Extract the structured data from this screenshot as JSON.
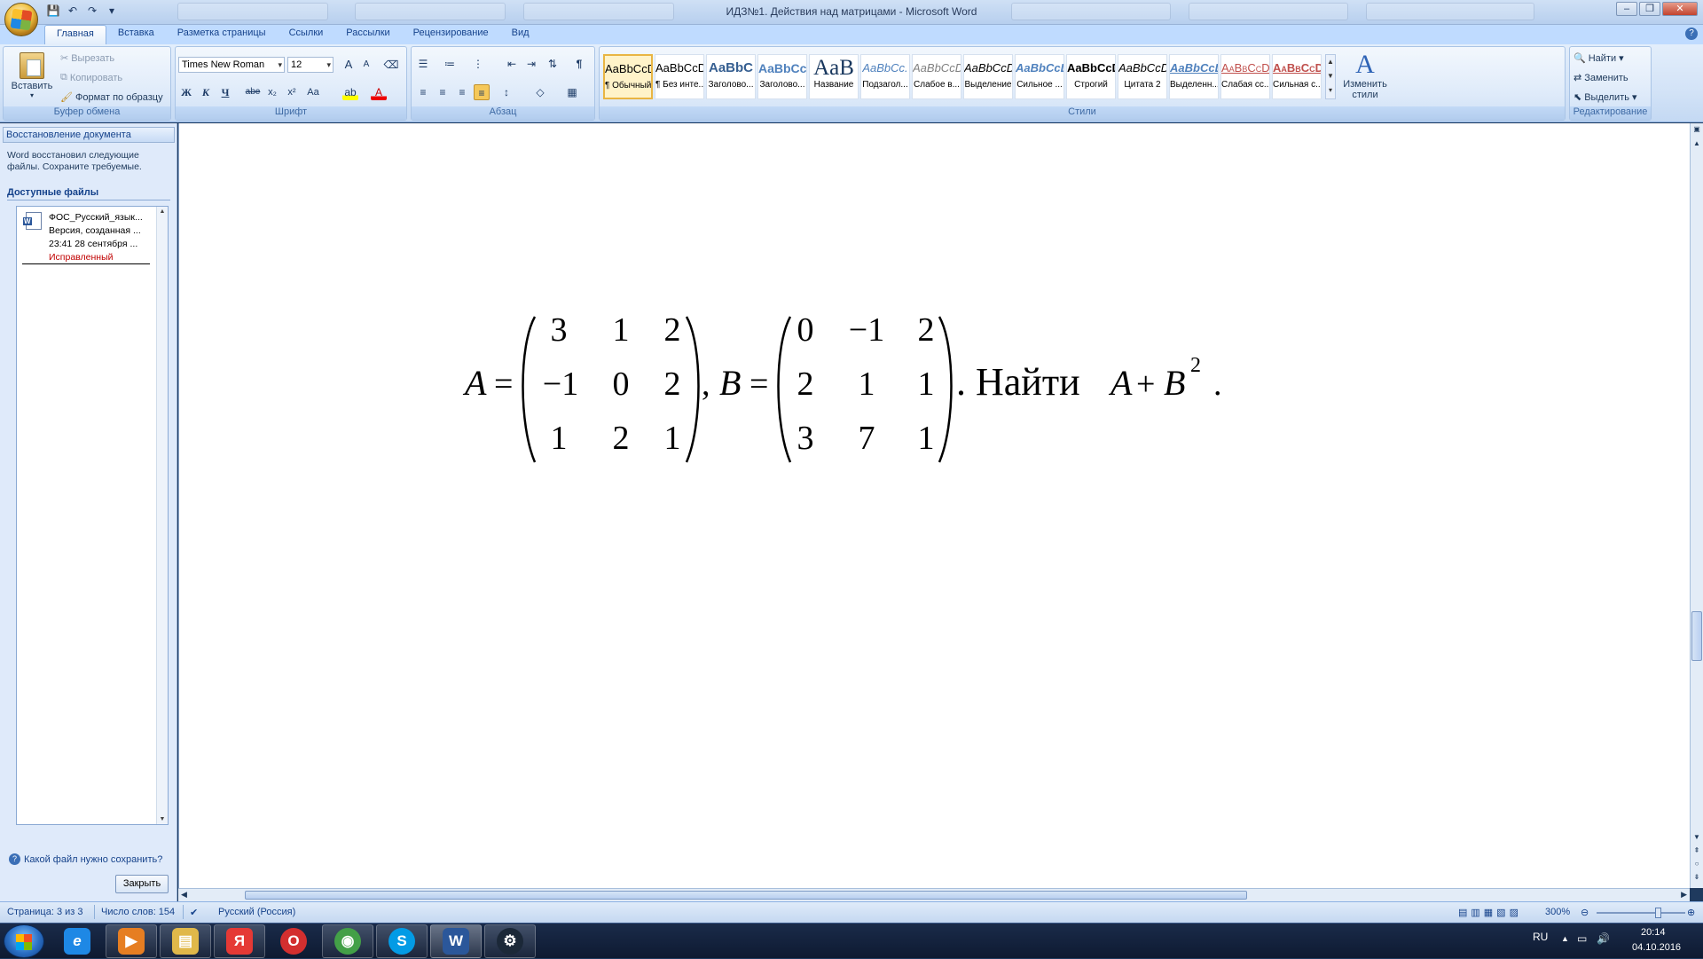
{
  "window": {
    "title": "ИДЗ№1. Действия над матрицами - Microsoft Word"
  },
  "qat": {
    "save": "💾",
    "undo": "↶",
    "redo": "↷",
    "more": "▾"
  },
  "tabs": [
    "Главная",
    "Вставка",
    "Разметка страницы",
    "Ссылки",
    "Рассылки",
    "Рецензирование",
    "Вид"
  ],
  "clipboard": {
    "paste": "Вставить",
    "cut": "Вырезать",
    "copy": "Копировать",
    "format_painter": "Формат по образцу",
    "label": "Буфер обмена"
  },
  "font": {
    "family": "Times New Roman",
    "size": "12",
    "label": "Шрифт",
    "bold": "Ж",
    "italic": "К",
    "underline": "Ч",
    "strike": "abe",
    "subscript": "x₂",
    "superscript": "x²",
    "change_case": "Aa",
    "grow": "A",
    "shrink": "A"
  },
  "paragraph": {
    "label": "Абзац"
  },
  "styles": {
    "label": "Стили",
    "items": [
      {
        "preview": "AaBbCcDc",
        "name": "¶ Обычный"
      },
      {
        "preview": "AaBbCcDc",
        "name": "¶ Без инте..."
      },
      {
        "preview": "AaBbC",
        "name": "Заголово..."
      },
      {
        "preview": "AaBbCc",
        "name": "Заголово..."
      },
      {
        "preview": "AaB",
        "name": "Название"
      },
      {
        "preview": "AaBbCc.",
        "name": "Подзагол..."
      },
      {
        "preview": "AaBbCcDı",
        "name": "Слабое в..."
      },
      {
        "preview": "AaBbCcDı",
        "name": "Выделение"
      },
      {
        "preview": "AaBbCcDı",
        "name": "Сильное ..."
      },
      {
        "preview": "AaBbCcDc",
        "name": "Строгий"
      },
      {
        "preview": "AaBbCcDı",
        "name": "Цитата 2"
      },
      {
        "preview": "AaBbCcDı",
        "name": "Выделенн..."
      },
      {
        "preview": "AaBbCcDı",
        "name": "Слабая сс..."
      },
      {
        "preview": "AaBbCcDı",
        "name": "Сильная с..."
      }
    ],
    "change_styles": "Изменить стили"
  },
  "editing": {
    "label": "Редактирование",
    "find": "Найти",
    "replace": "Заменить",
    "select": "Выделить"
  },
  "taskpane": {
    "title": "Восстановление документа",
    "text": "Word восстановил следующие файлы.  Сохраните требуемые.",
    "available": "Доступные файлы",
    "file": {
      "name": "ФОС_Русский_язык...",
      "line2": "Версия, созданная ...",
      "line3": "23:41 28 сентября ...",
      "status": "Исправленный"
    },
    "question": "Какой файл нужно сохранить?",
    "close": "Закрыть"
  },
  "document": {
    "matrix_a": [
      [
        "3",
        "1",
        "2"
      ],
      [
        "−1",
        "0",
        "2"
      ],
      [
        "1",
        "2",
        "1"
      ]
    ],
    "matrix_b": [
      [
        "0",
        "−1",
        "2"
      ],
      [
        "2",
        "1",
        "1"
      ],
      [
        "3",
        "7",
        "1"
      ]
    ],
    "var_a": "A",
    "var_b": "B",
    "equals": "=",
    "comma": ",",
    "task_text": ". Найти",
    "expr_a": "A",
    "plus": "+",
    "expr_b": "B",
    "power": "2",
    "period": "."
  },
  "statusbar": {
    "page": "Страница: 3 из 3",
    "words": "Число слов: 154",
    "language": "Русский (Россия)",
    "zoom": "300%"
  },
  "tray": {
    "lang": "RU",
    "time": "20:14",
    "date": "04.10.2016"
  },
  "taskbar_apps": [
    {
      "name": "internet-explorer-icon",
      "glyph": "e",
      "color": "#1e88e5"
    },
    {
      "name": "media-player-icon",
      "glyph": "▶",
      "color": "#e67e22"
    },
    {
      "name": "file-explorer-icon",
      "glyph": "▤",
      "color": "#e0b84a"
    },
    {
      "name": "yandex-browser-icon",
      "glyph": "Я",
      "color": "#e53935"
    },
    {
      "name": "opera-icon",
      "glyph": "O",
      "color": "#d32f2f"
    },
    {
      "name": "chrome-icon",
      "glyph": "◉",
      "color": "#43a047"
    },
    {
      "name": "skype-icon",
      "glyph": "S",
      "color": "#039be5"
    },
    {
      "name": "word-icon",
      "glyph": "W",
      "color": "#2b579a"
    },
    {
      "name": "steam-icon",
      "glyph": "⚙",
      "color": "#1b2838"
    }
  ]
}
